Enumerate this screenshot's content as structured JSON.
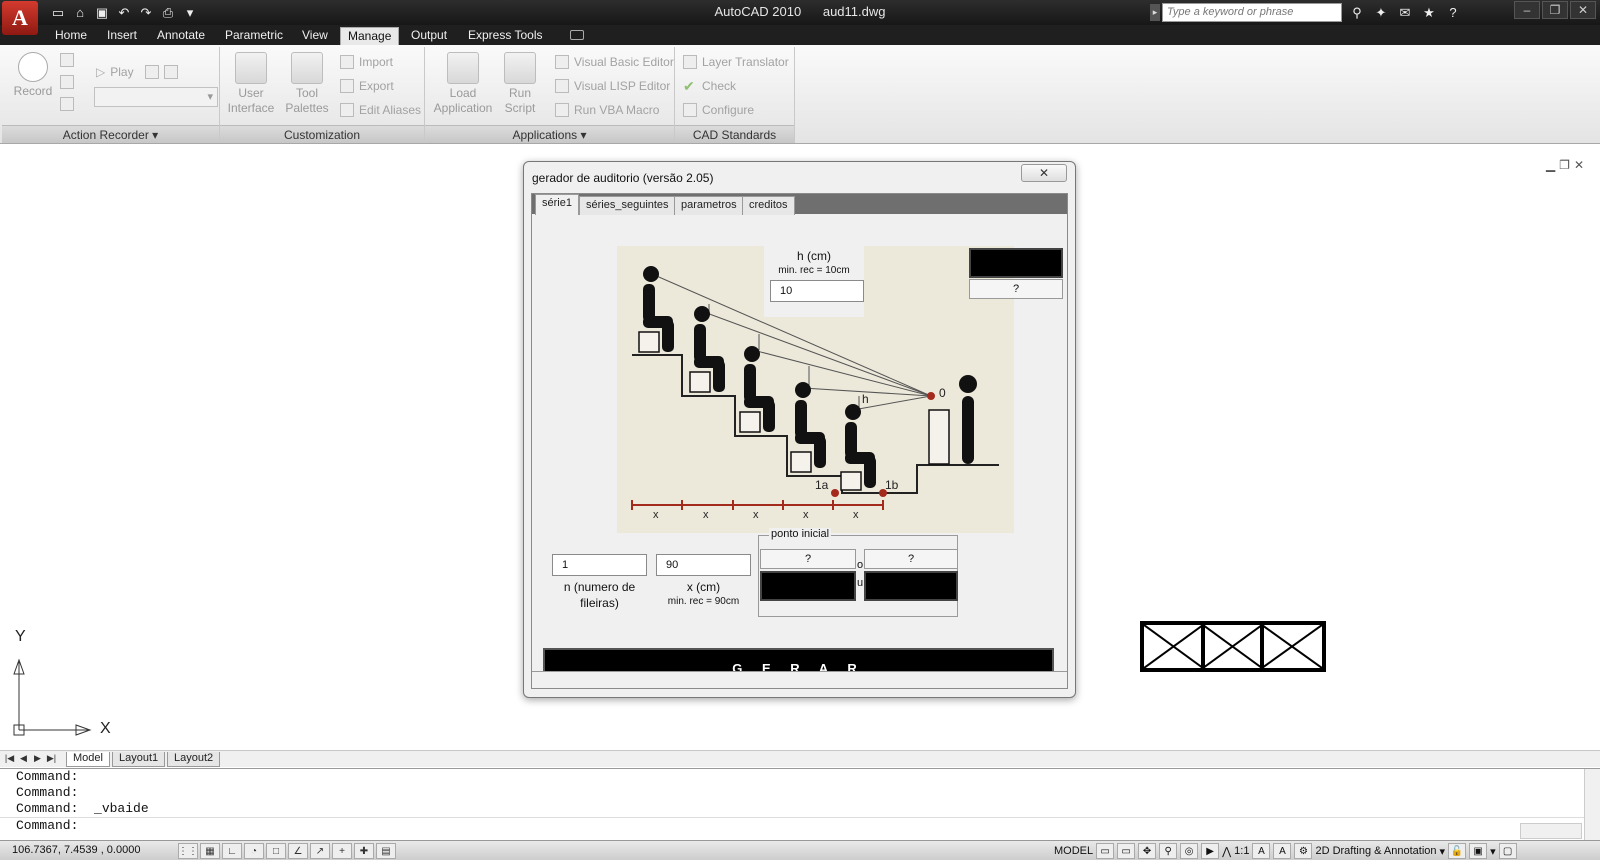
{
  "app": {
    "logo": "A",
    "title": "AutoCAD 2010",
    "file": "aud11.dwg",
    "search_placeholder": "Type a keyword or phrase"
  },
  "qat_icons": [
    "new-file-icon",
    "open-file-icon",
    "save-icon",
    "undo-icon",
    "redo-icon",
    "plot-icon"
  ],
  "ribbon_tabs": [
    {
      "label": "Home"
    },
    {
      "label": "Insert"
    },
    {
      "label": "Annotate"
    },
    {
      "label": "Parametric"
    },
    {
      "label": "View"
    },
    {
      "label": "Manage",
      "active": true
    },
    {
      "label": "Output"
    },
    {
      "label": "Express Tools"
    }
  ],
  "panels": {
    "action_recorder": {
      "title": "Action Recorder",
      "record": "Record",
      "play": "Play"
    },
    "customization": {
      "title": "Customization",
      "user_interface": "User\nInterface",
      "ui_line1": "User",
      "ui_line2": "Interface",
      "tp_line1": "Tool",
      "tp_line2": "Palettes",
      "import": "Import",
      "export": "Export",
      "edit_aliases": "Edit Aliases"
    },
    "applications": {
      "title": "Applications",
      "load_line1": "Load",
      "load_line2": "Application",
      "run_line1": "Run",
      "run_line2": "Script",
      "vbe": "Visual Basic Editor",
      "vlisp": "Visual LISP Editor",
      "vba": "Run VBA Macro"
    },
    "cad_standards": {
      "title": "CAD Standards",
      "layer_translator": "Layer Translator",
      "check": "Check",
      "configure": "Configure"
    }
  },
  "dialog": {
    "title": "gerador de auditorio (versão 2.05)",
    "close": "✕",
    "tabs": [
      "série1",
      "séries_seguintes",
      "parametros",
      "creditos"
    ],
    "h_label": "h (cm)",
    "h_sub": "min. rec = 10cm",
    "h_value": "10",
    "help_q": "?",
    "n_value": "1",
    "n_label_1": "n (numero de",
    "n_label_2": "fileiras)",
    "x_value": "90",
    "x_label": "x (cm)",
    "x_sub": "min. rec = 90cm",
    "ponto_inicial": "ponto inicial",
    "q1": "?",
    "q2": "?",
    "ou_o": "o",
    "ou_u": "u",
    "gerar": "G E R A R",
    "illus": {
      "zero": "0",
      "h": "h",
      "p1a": "1a",
      "p1b": "1b",
      "x": "x"
    }
  },
  "layout_tabs": [
    "Model",
    "Layout1",
    "Layout2"
  ],
  "ucs": {
    "y": "Y",
    "x": "X"
  },
  "command_lines": [
    "Command:",
    "Command:",
    "Command:  _vbaide",
    "Command:"
  ],
  "status": {
    "coords": "106.7367, 7.4539 , 0.0000",
    "model": "MODEL",
    "scale": "1:1",
    "workspace": "2D Drafting & Annotation"
  }
}
